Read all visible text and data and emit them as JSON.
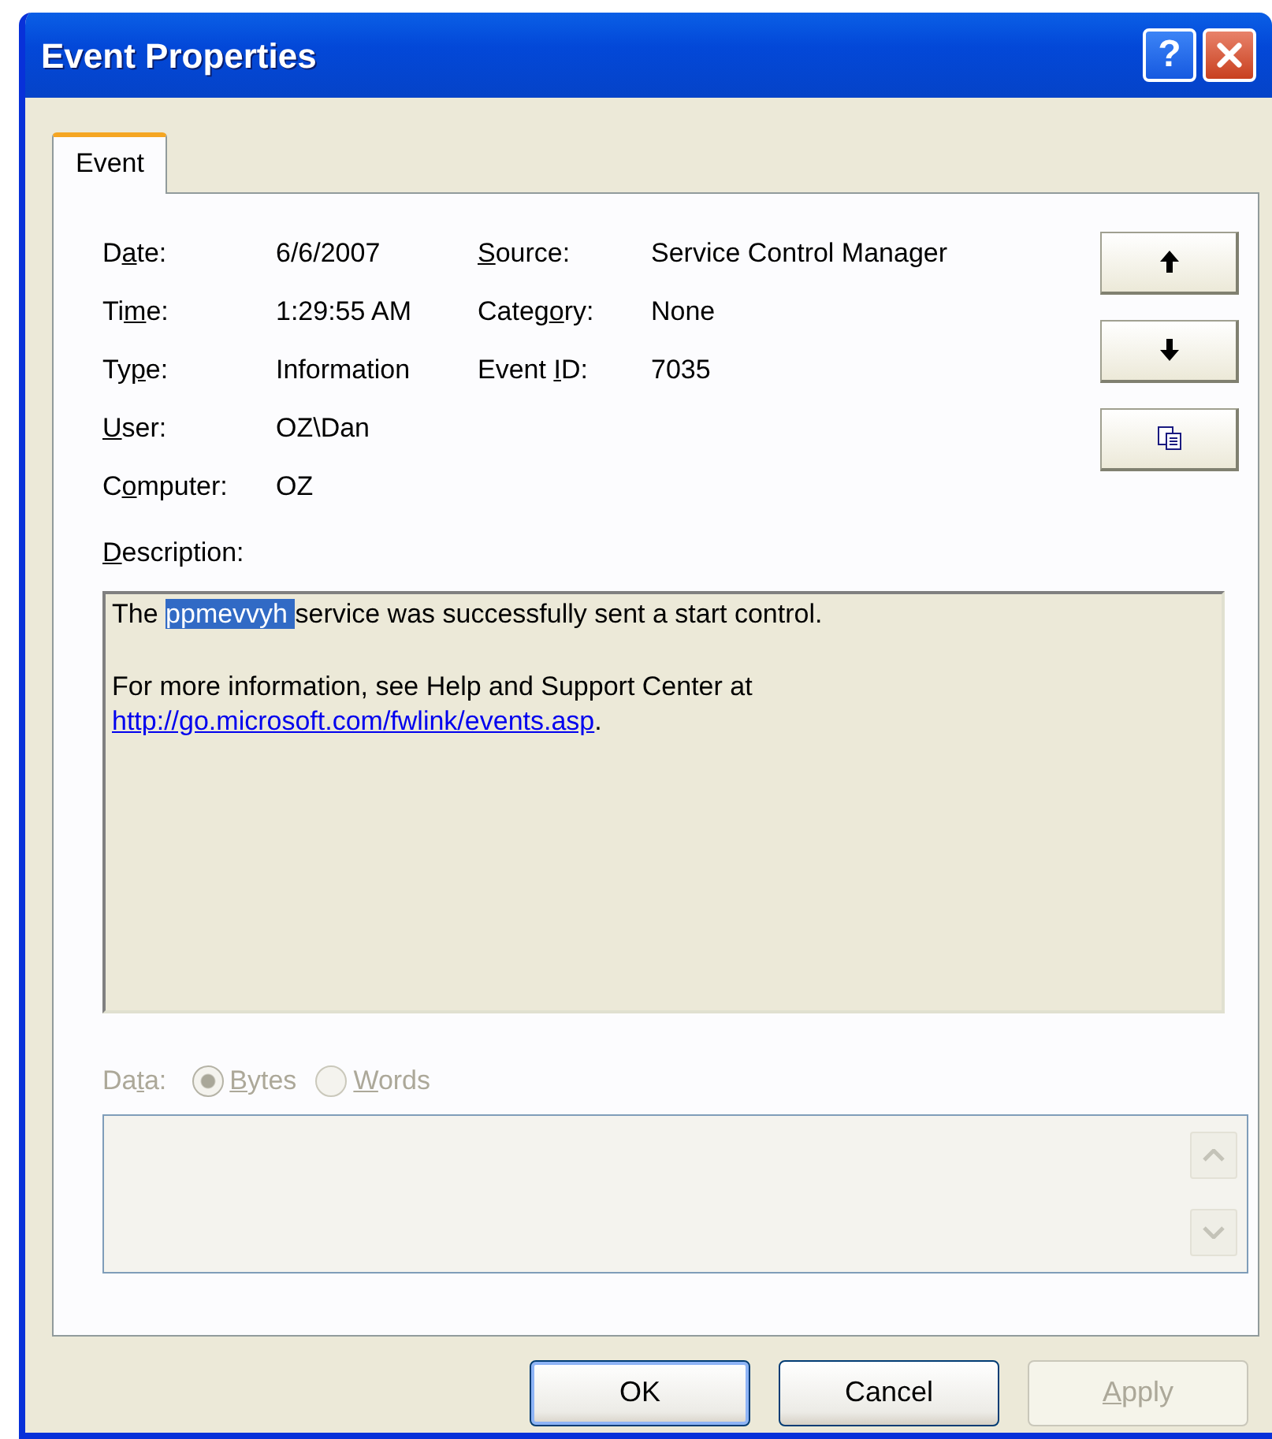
{
  "window": {
    "title": "Event Properties",
    "help_button": "?"
  },
  "tabs": [
    {
      "label": "Event",
      "selected": true
    }
  ],
  "fields": [
    {
      "label": {
        "before": "D",
        "key": "a",
        "after": "te:"
      },
      "value": "6/6/2007"
    },
    {
      "label": {
        "before": "Ti",
        "key": "m",
        "after": "e:"
      },
      "value": "1:29:55 AM"
    },
    {
      "label": {
        "before": "Ty",
        "key": "p",
        "after": "e:"
      },
      "value": "Information"
    },
    {
      "label": {
        "key": "U",
        "after": "ser:"
      },
      "value": "OZ\\Dan"
    },
    {
      "label": {
        "before": "C",
        "key": "o",
        "after": "mputer:"
      },
      "value": "OZ"
    }
  ],
  "fields_right": [
    {
      "label": {
        "key": "S",
        "after": "ource:"
      },
      "value": "Service Control Manager"
    },
    {
      "label": {
        "before": "Categ",
        "key": "o",
        "after": "ry:"
      },
      "value": "None"
    },
    {
      "label": {
        "before": "Event ",
        "key": "I",
        "after": "D:"
      },
      "value": "7035"
    }
  ],
  "side_buttons": [
    {
      "kind": "up"
    },
    {
      "kind": "down"
    },
    {
      "kind": "copy"
    }
  ],
  "description": {
    "label": {
      "key": "D",
      "after": "escription:"
    },
    "paragraphs": [
      [
        {
          "kind": "text",
          "text": "The ",
          "selected": false
        },
        {
          "kind": "text",
          "text": "ppmevvyh ",
          "selected": true
        },
        {
          "kind": "text",
          "text": "service was successfully sent a start control.",
          "selected": false
        }
      ],
      [
        {
          "kind": "text",
          "text": "For more information, see Help and Support Center at ",
          "selected": false
        },
        {
          "kind": "link",
          "text": "http://go.microsoft.com/fwlink/events.asp",
          "selected": false
        },
        {
          "kind": "text",
          "text": ".",
          "selected": false
        }
      ]
    ]
  },
  "data": {
    "disabled": true,
    "label": {
      "before": "Da",
      "key": "t",
      "after": "a:"
    },
    "options": [
      {
        "label": {
          "key": "B",
          "after": "ytes"
        },
        "selected": true
      },
      {
        "label": {
          "key": "W",
          "after": "ords"
        },
        "selected": false
      }
    ]
  },
  "buttons": [
    {
      "label": {
        "before": "OK"
      },
      "default": true,
      "disabled": false
    },
    {
      "label": {
        "before": "Cancel"
      },
      "default": false,
      "disabled": false
    },
    {
      "label": {
        "key": "A",
        "after": "pply"
      },
      "default": false,
      "disabled": true
    }
  ]
}
